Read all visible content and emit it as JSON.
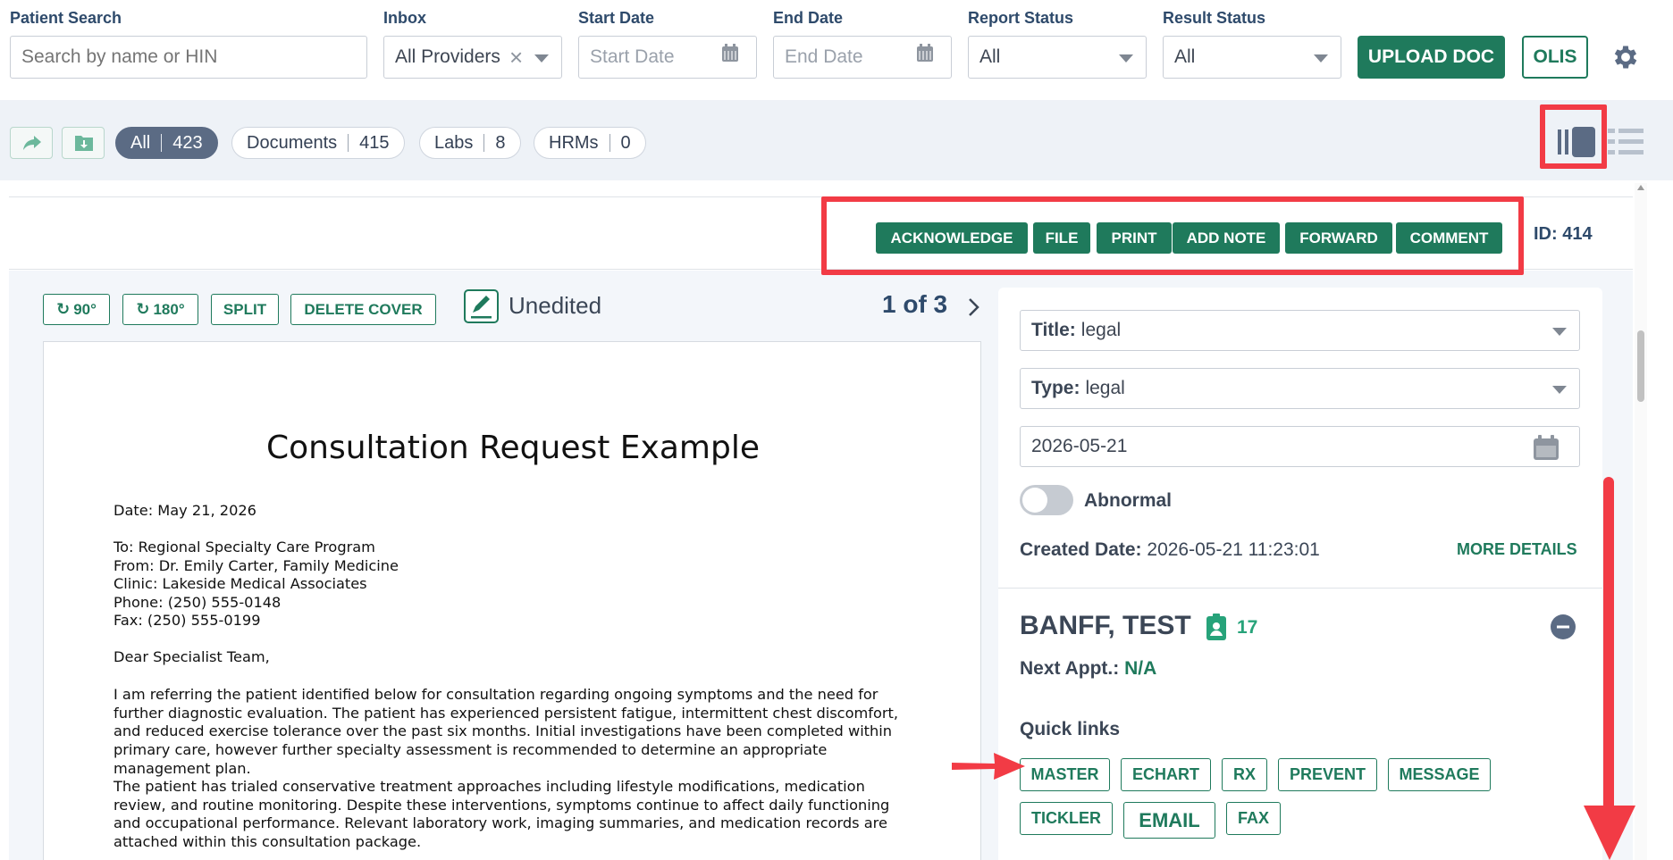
{
  "filters": {
    "patient_search": {
      "label": "Patient Search",
      "placeholder": "Search by name or HIN"
    },
    "inbox": {
      "label": "Inbox",
      "value": "All Providers"
    },
    "start_date": {
      "label": "Start Date",
      "placeholder": "Start Date"
    },
    "end_date": {
      "label": "End Date",
      "placeholder": "End Date"
    },
    "report_status": {
      "label": "Report Status",
      "value": "All"
    },
    "result_status": {
      "label": "Result Status",
      "value": "All"
    },
    "upload_label": "UPLOAD DOC",
    "olis_label": "OLIS"
  },
  "tabs": [
    {
      "label": "All",
      "count": "423"
    },
    {
      "label": "Documents",
      "count": "415"
    },
    {
      "label": "Labs",
      "count": "8"
    },
    {
      "label": "HRMs",
      "count": "0"
    }
  ],
  "actions": {
    "acknowledge": "ACKNOWLEDGE",
    "file": "FILE",
    "print": "PRINT",
    "add_note": "ADD NOTE",
    "forward": "FORWARD",
    "comment": "COMMENT",
    "doc_id": "ID: 414"
  },
  "viewer": {
    "rotate90": "90°",
    "rotate180": "180°",
    "split": "SPLIT",
    "delete_cover": "DELETE COVER",
    "edit_status": "Unedited",
    "page_indicator": "1 of 3"
  },
  "document": {
    "title": "Consultation Request Example",
    "date_line": "Date: May 21, 2026",
    "to_line": "To: Regional Specialty Care Program",
    "from_line": "From: Dr. Emily Carter, Family Medicine",
    "clinic_line": "Clinic: Lakeside Medical Associates",
    "phone_line": "Phone: (250) 555-0148",
    "fax_line": "Fax: (250) 555-0199",
    "greeting": "Dear Specialist Team,",
    "para1": "I am referring the patient identified below for consultation regarding ongoing symptoms and the need for further diagnostic evaluation. The patient has experienced persistent fatigue, intermittent chest discomfort, and reduced exercise tolerance over the past six months. Initial investigations have been completed within primary care, however further specialty assessment is recommended to determine an appropriate management plan.",
    "para2": "The patient has trialed conservative treatment approaches including lifestyle modifications, medication review, and routine monitoring. Despite these interventions, symptoms continue to affect daily functioning and occupational performance. Relevant laboratory work, imaging summaries, and medication records are attached within this consultation package."
  },
  "details": {
    "title_label": "Title:",
    "title_value": "legal",
    "type_label": "Type:",
    "type_value": "legal",
    "date_value": "2026-05-21",
    "abnormal_label": "Abnormal",
    "created_label": "Created Date:",
    "created_value": "2026-05-21 11:23:01",
    "more_details": "MORE DETAILS"
  },
  "patient": {
    "name": "BANFF, TEST",
    "age": "17",
    "next_appt_label": "Next Appt.:",
    "next_appt_value": "N/A",
    "quick_links_label": "Quick links",
    "links": [
      "MASTER",
      "ECHART",
      "RX",
      "PREVENT",
      "MESSAGE",
      "TICKLER",
      "EMAIL",
      "FAX"
    ]
  },
  "colors": {
    "accent": "#1f7a5c",
    "annotation": "#f23b45",
    "pill_active": "#5b6b84",
    "heading": "#2e4a6b"
  }
}
